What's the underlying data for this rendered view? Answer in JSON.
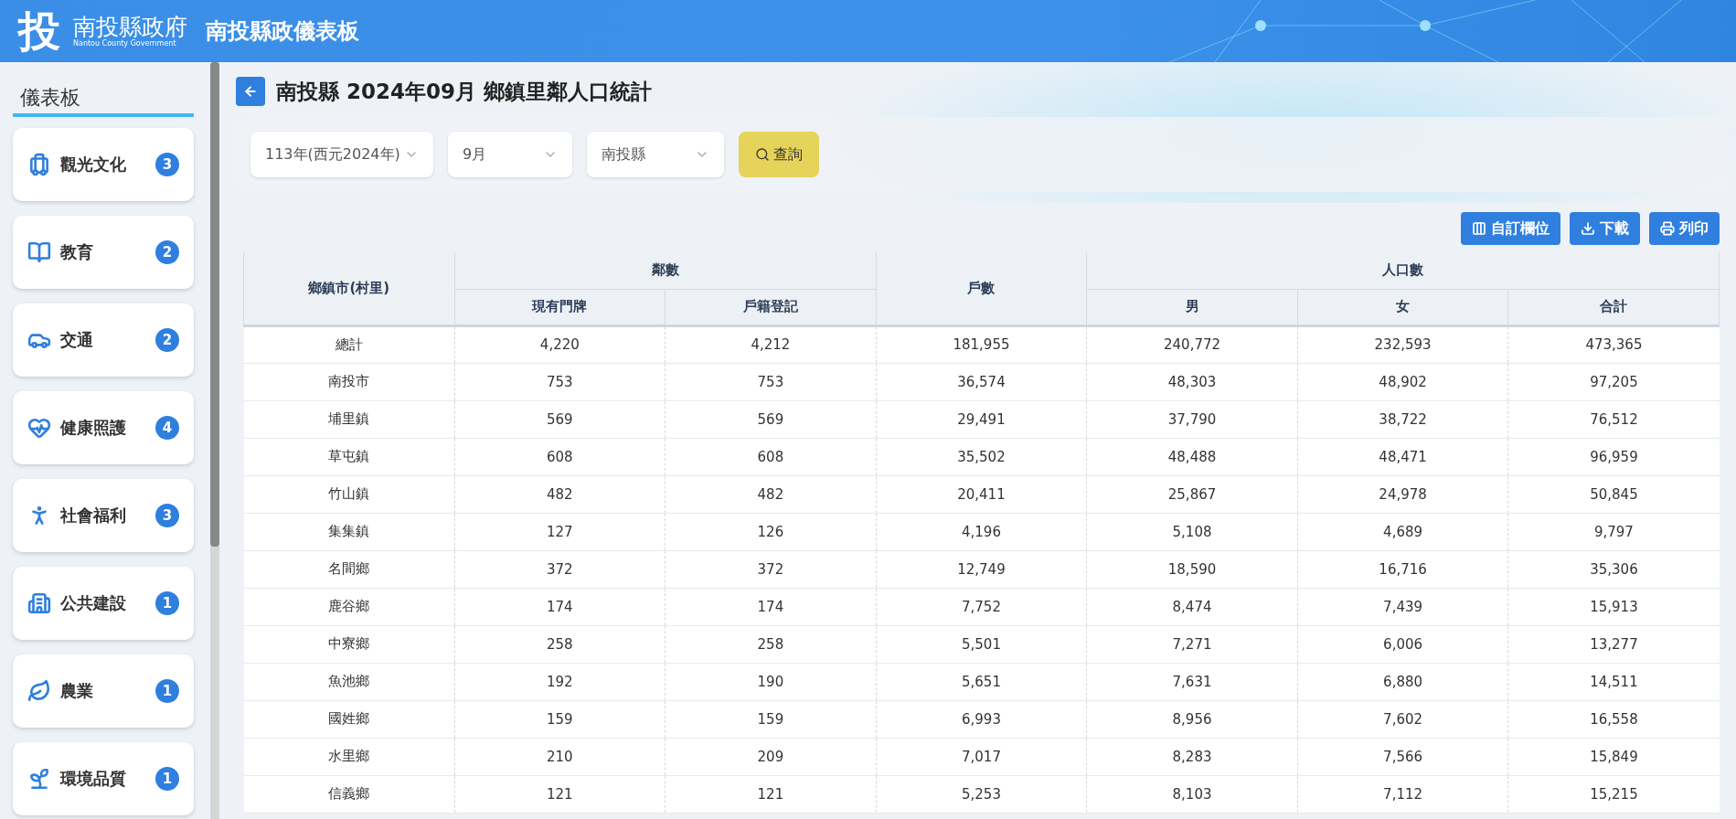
{
  "header": {
    "logo_mark": "投",
    "logo_name": "南投縣政府",
    "logo_subtitle": "Nantou County Government",
    "title": "南投縣政儀表板"
  },
  "sidebar": {
    "heading": "儀表板",
    "items": [
      {
        "label": "觀光文化",
        "count": "3"
      },
      {
        "label": "教育",
        "count": "2"
      },
      {
        "label": "交通",
        "count": "2"
      },
      {
        "label": "健康照護",
        "count": "4"
      },
      {
        "label": "社會福利",
        "count": "3"
      },
      {
        "label": "公共建設",
        "count": "1"
      },
      {
        "label": "農業",
        "count": "1"
      },
      {
        "label": "環境品質",
        "count": "1"
      }
    ]
  },
  "page": {
    "title": "南投縣 2024年09月 鄉鎮里鄰人口統計"
  },
  "filters": [
    {
      "value": "113年(西元2024年)"
    },
    {
      "value": "9月"
    },
    {
      "value": "南投縣"
    }
  ],
  "search_button": "查詢",
  "toolbar": [
    "自訂欄位",
    "下載",
    "列印"
  ],
  "table": {
    "groups": [
      {
        "label": "鄉鎮市(村里)"
      },
      {
        "label": "鄰數",
        "children": [
          "現有門牌",
          "戶籍登記"
        ]
      },
      {
        "label": "戶數"
      },
      {
        "label": "人口數",
        "children": [
          "男",
          "女",
          "合計"
        ]
      }
    ],
    "rows": [
      [
        "總計",
        "4,220",
        "4,212",
        "181,955",
        "240,772",
        "232,593",
        "473,365"
      ],
      [
        "南投市",
        "753",
        "753",
        "36,574",
        "48,303",
        "48,902",
        "97,205"
      ],
      [
        "埔里鎮",
        "569",
        "569",
        "29,491",
        "37,790",
        "38,722",
        "76,512"
      ],
      [
        "草屯鎮",
        "608",
        "608",
        "35,502",
        "48,488",
        "48,471",
        "96,959"
      ],
      [
        "竹山鎮",
        "482",
        "482",
        "20,411",
        "25,867",
        "24,978",
        "50,845"
      ],
      [
        "集集鎮",
        "127",
        "126",
        "4,196",
        "5,108",
        "4,689",
        "9,797"
      ],
      [
        "名間鄉",
        "372",
        "372",
        "12,749",
        "18,590",
        "16,716",
        "35,306"
      ],
      [
        "鹿谷鄉",
        "174",
        "174",
        "7,752",
        "8,474",
        "7,439",
        "15,913"
      ],
      [
        "中寮鄉",
        "258",
        "258",
        "5,501",
        "7,271",
        "6,006",
        "13,277"
      ],
      [
        "魚池鄉",
        "192",
        "190",
        "5,651",
        "7,631",
        "6,880",
        "14,511"
      ],
      [
        "國姓鄉",
        "159",
        "159",
        "6,993",
        "8,956",
        "7,602",
        "16,558"
      ],
      [
        "水里鄉",
        "210",
        "209",
        "7,017",
        "8,283",
        "7,566",
        "15,849"
      ],
      [
        "信義鄉",
        "121",
        "121",
        "5,253",
        "8,103",
        "7,112",
        "15,215"
      ]
    ]
  }
}
